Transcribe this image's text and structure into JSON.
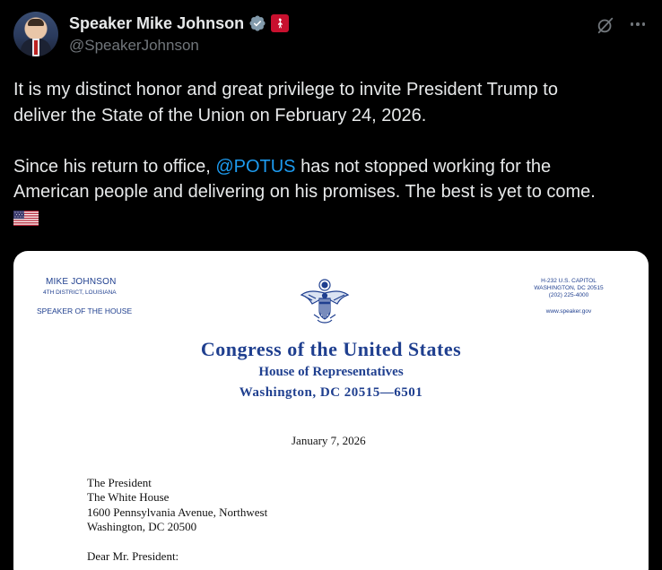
{
  "author": {
    "display_name": "Speaker Mike Johnson",
    "handle": "@SpeakerJohnson"
  },
  "tweet": {
    "line1": "It is my distinct honor and great privilege to invite President Trump to",
    "line2": "deliver the State of the Union on February 24, 2026.",
    "p2_before": "Since his return to office, ",
    "mention": "@POTUS",
    "p2_after": " has not stopped working for the",
    "line4": "American people and delivering on his promises. The best is yet to come."
  },
  "letter": {
    "left_name": "MIKE JOHNSON",
    "left_district": "4TH DISTRICT, LOUISIANA",
    "left_title": "SPEAKER OF THE HOUSE",
    "right_addr1": "H-232 U.S. CAPITOL",
    "right_addr2": "WASHINGTON, DC 20515",
    "right_phone": "(202) 225-4000",
    "right_web": "www.speaker.gov",
    "heading1": "Congress of the United States",
    "heading2": "House of Representatives",
    "heading3": "Washington, DC 20515—6501",
    "date": "January 7, 2026",
    "address": [
      "The President",
      "The White House",
      "1600 Pennsylvania Avenue, Northwest",
      "Washington, DC  20500"
    ],
    "salutation": "Dear Mr. President:"
  },
  "colors": {
    "background": "#000000",
    "text": "#e7e9ea",
    "secondary": "#71767b",
    "link": "#1d9bf0",
    "letterhead_blue": "#1f3f8f"
  },
  "icons": [
    "verified-icon",
    "affiliate-badge-icon",
    "grok-icon",
    "more-icon",
    "us-flag-icon",
    "eagle-seal-icon"
  ]
}
